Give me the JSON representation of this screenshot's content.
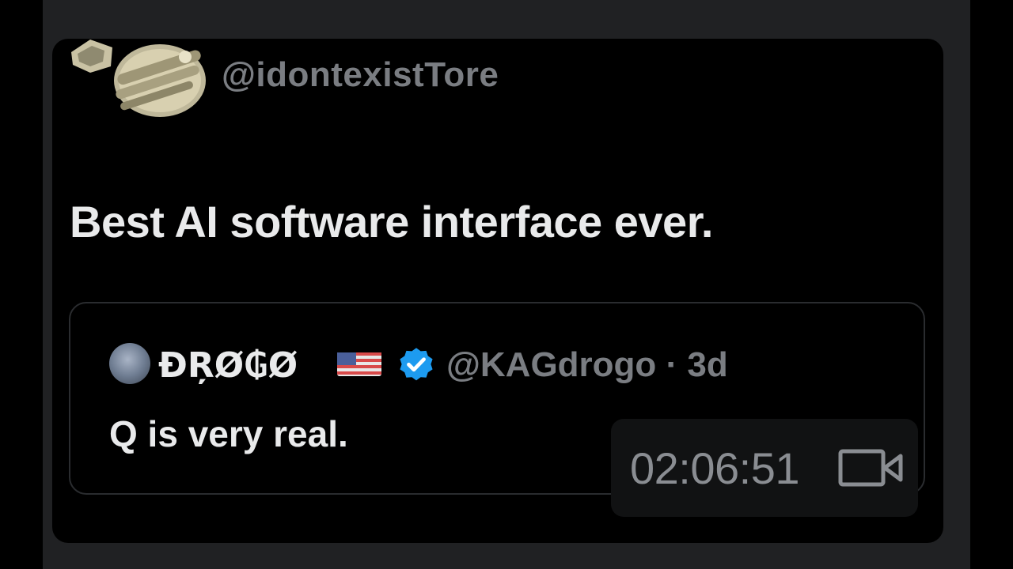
{
  "tweet": {
    "handle": "@idontexistTore",
    "text": "Best AI software interface ever."
  },
  "quoted_tweet": {
    "display_name": "ĐŖØ₲Ø",
    "handle_time": "@KAGdrogo · 3d",
    "text": "Q is very real.",
    "flag_icon": "us-flag-icon",
    "verified_icon": "verified-badge-icon"
  },
  "video": {
    "duration": "02:06:51",
    "icon": "video-camera-icon"
  },
  "colors": {
    "background": "#000000",
    "frame": "#202123",
    "text_primary": "#e9eaeb",
    "text_secondary": "#7a7d82",
    "verified_blue": "#1d9bf0"
  }
}
